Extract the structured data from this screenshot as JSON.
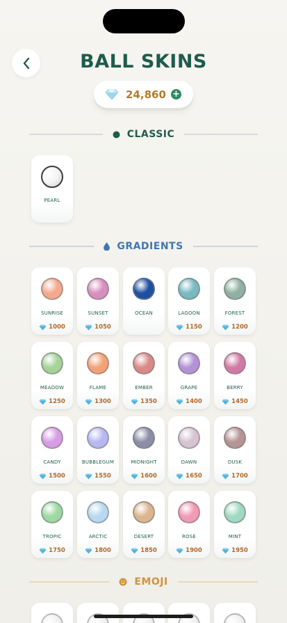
{
  "header": {
    "title": "BALL SKINS",
    "back_icon": "chevron-left-icon"
  },
  "currency": {
    "amount": "24,860",
    "icon": "diamond-icon",
    "add_icon": "plus-icon"
  },
  "sections": {
    "classic": {
      "title": "CLASSIC",
      "icon": "dot-icon",
      "color": "#1e5c4c"
    },
    "gradients": {
      "title": "GRADIENTS",
      "icon": "drop-icon",
      "color": "#3f77b5"
    },
    "emoji": {
      "title": "EMOJI",
      "icon": "smiley-icon",
      "color": "#d29336"
    }
  },
  "classic_items": [
    {
      "name": "PEARL",
      "color": "#ffffff"
    }
  ],
  "gradient_items": [
    {
      "name": "SUNRISE",
      "price": "1000",
      "color": "#f4a98e"
    },
    {
      "name": "SUNSET",
      "price": "1050",
      "color": "#d88fbf"
    },
    {
      "name": "OCEAN",
      "price": "",
      "color": "#1f4fa0"
    },
    {
      "name": "LAGOON",
      "price": "1150",
      "color": "#79b9c0"
    },
    {
      "name": "FOREST",
      "price": "1200",
      "color": "#8fb0a3"
    },
    {
      "name": "MEADOW",
      "price": "1250",
      "color": "#a5d39a"
    },
    {
      "name": "FLAME",
      "price": "1300",
      "color": "#f3a278"
    },
    {
      "name": "EMBER",
      "price": "1350",
      "color": "#d98a86"
    },
    {
      "name": "GRAPE",
      "price": "1400",
      "color": "#b492d8"
    },
    {
      "name": "BERRY",
      "price": "1450",
      "color": "#d27aa6"
    },
    {
      "name": "CANDY",
      "price": "1500",
      "color": "#d89ce4"
    },
    {
      "name": "BUBBLEGUM",
      "price": "1550",
      "color": "#b8b8f0"
    },
    {
      "name": "MIDNIGHT",
      "price": "1600",
      "color": "#8b8ea6"
    },
    {
      "name": "DAWN",
      "price": "1650",
      "color": "#d7c3d2"
    },
    {
      "name": "DUSK",
      "price": "1700",
      "color": "#b69396"
    },
    {
      "name": "TROPIC",
      "price": "1750",
      "color": "#9ed8a3"
    },
    {
      "name": "ARCTIC",
      "price": "1800",
      "color": "#b8d8f0"
    },
    {
      "name": "DESERT",
      "price": "1850",
      "color": "#dcb58e"
    },
    {
      "name": "ROSE",
      "price": "1900",
      "color": "#f09ab4"
    },
    {
      "name": "MINT",
      "price": "1950",
      "color": "#9fd9c2"
    }
  ],
  "emoji_items_partial": 5
}
